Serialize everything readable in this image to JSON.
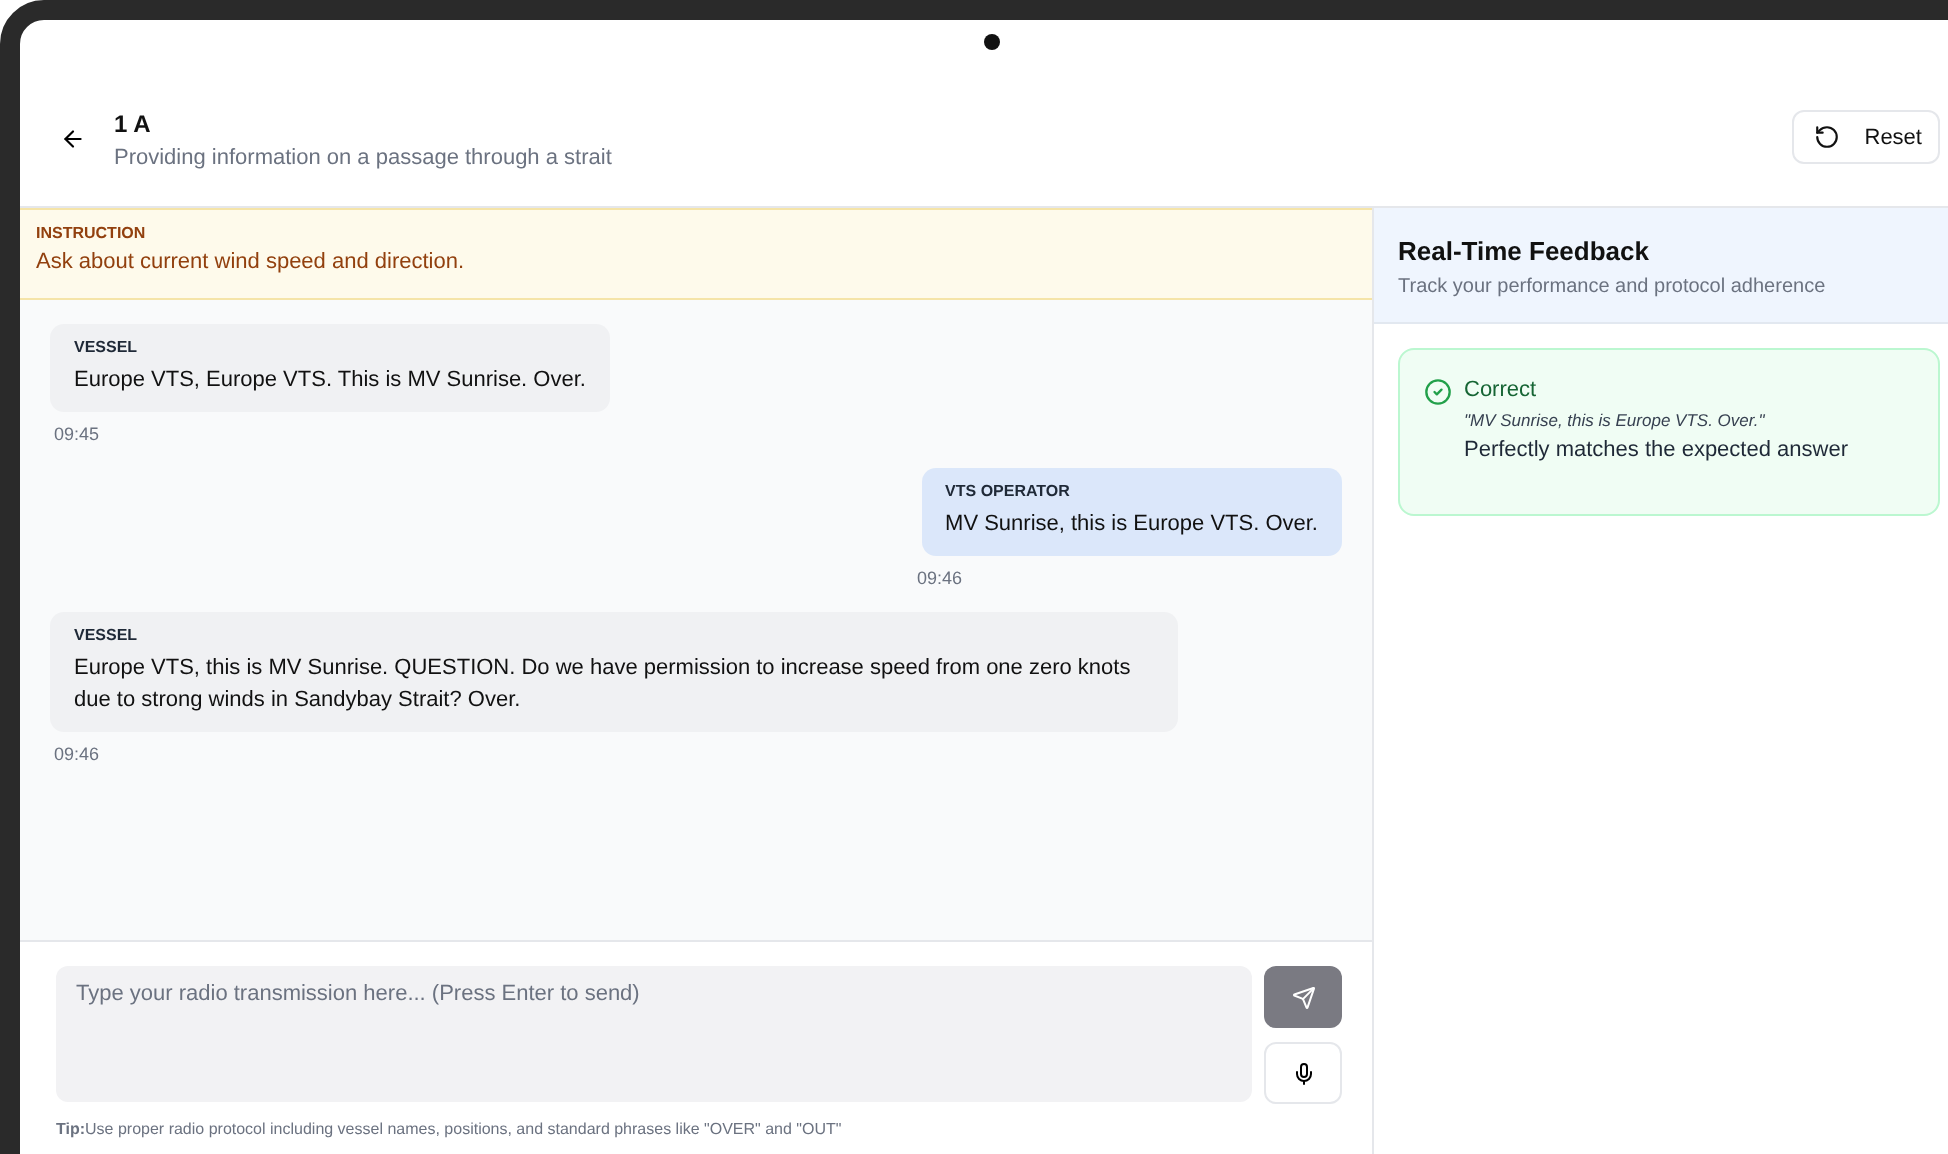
{
  "header": {
    "title": "1 A",
    "subtitle": "Providing information on a passage through a strait",
    "reset_button": "Reset"
  },
  "instruction": {
    "label": "INSTRUCTION",
    "text": "Ask about current wind speed and direction."
  },
  "messages": [
    {
      "kind": "vessel",
      "sender": "VESSEL",
      "text": "Europe VTS, Europe VTS. This is MV Sunrise. Over.",
      "time": "09:45"
    },
    {
      "kind": "operator",
      "sender": "VTS OPERATOR",
      "text": "MV Sunrise, this is Europe VTS. Over.",
      "time": "09:46"
    },
    {
      "kind": "vessel",
      "sender": "VESSEL",
      "text": "Europe VTS, this is MV Sunrise. QUESTION. Do we have permission to increase speed from one zero knots due to strong winds in Sandybay Strait? Over.",
      "time": "09:46"
    }
  ],
  "composer": {
    "placeholder": "Type your radio transmission here... (Press Enter to send)",
    "tip": "**Tip:**Use proper radio protocol including vessel names, positions, and standard phrases like \"OVER\" and \"OUT\""
  },
  "feedback": {
    "title": "Real-Time Feedback",
    "subtitle": "Track your performance and protocol adherence",
    "items": [
      {
        "kind": "correct",
        "title": "Correct",
        "quote": "\"MV Sunrise, this is Europe VTS. Over.\"",
        "detail": "Perfectly matches the expected answer"
      }
    ]
  }
}
